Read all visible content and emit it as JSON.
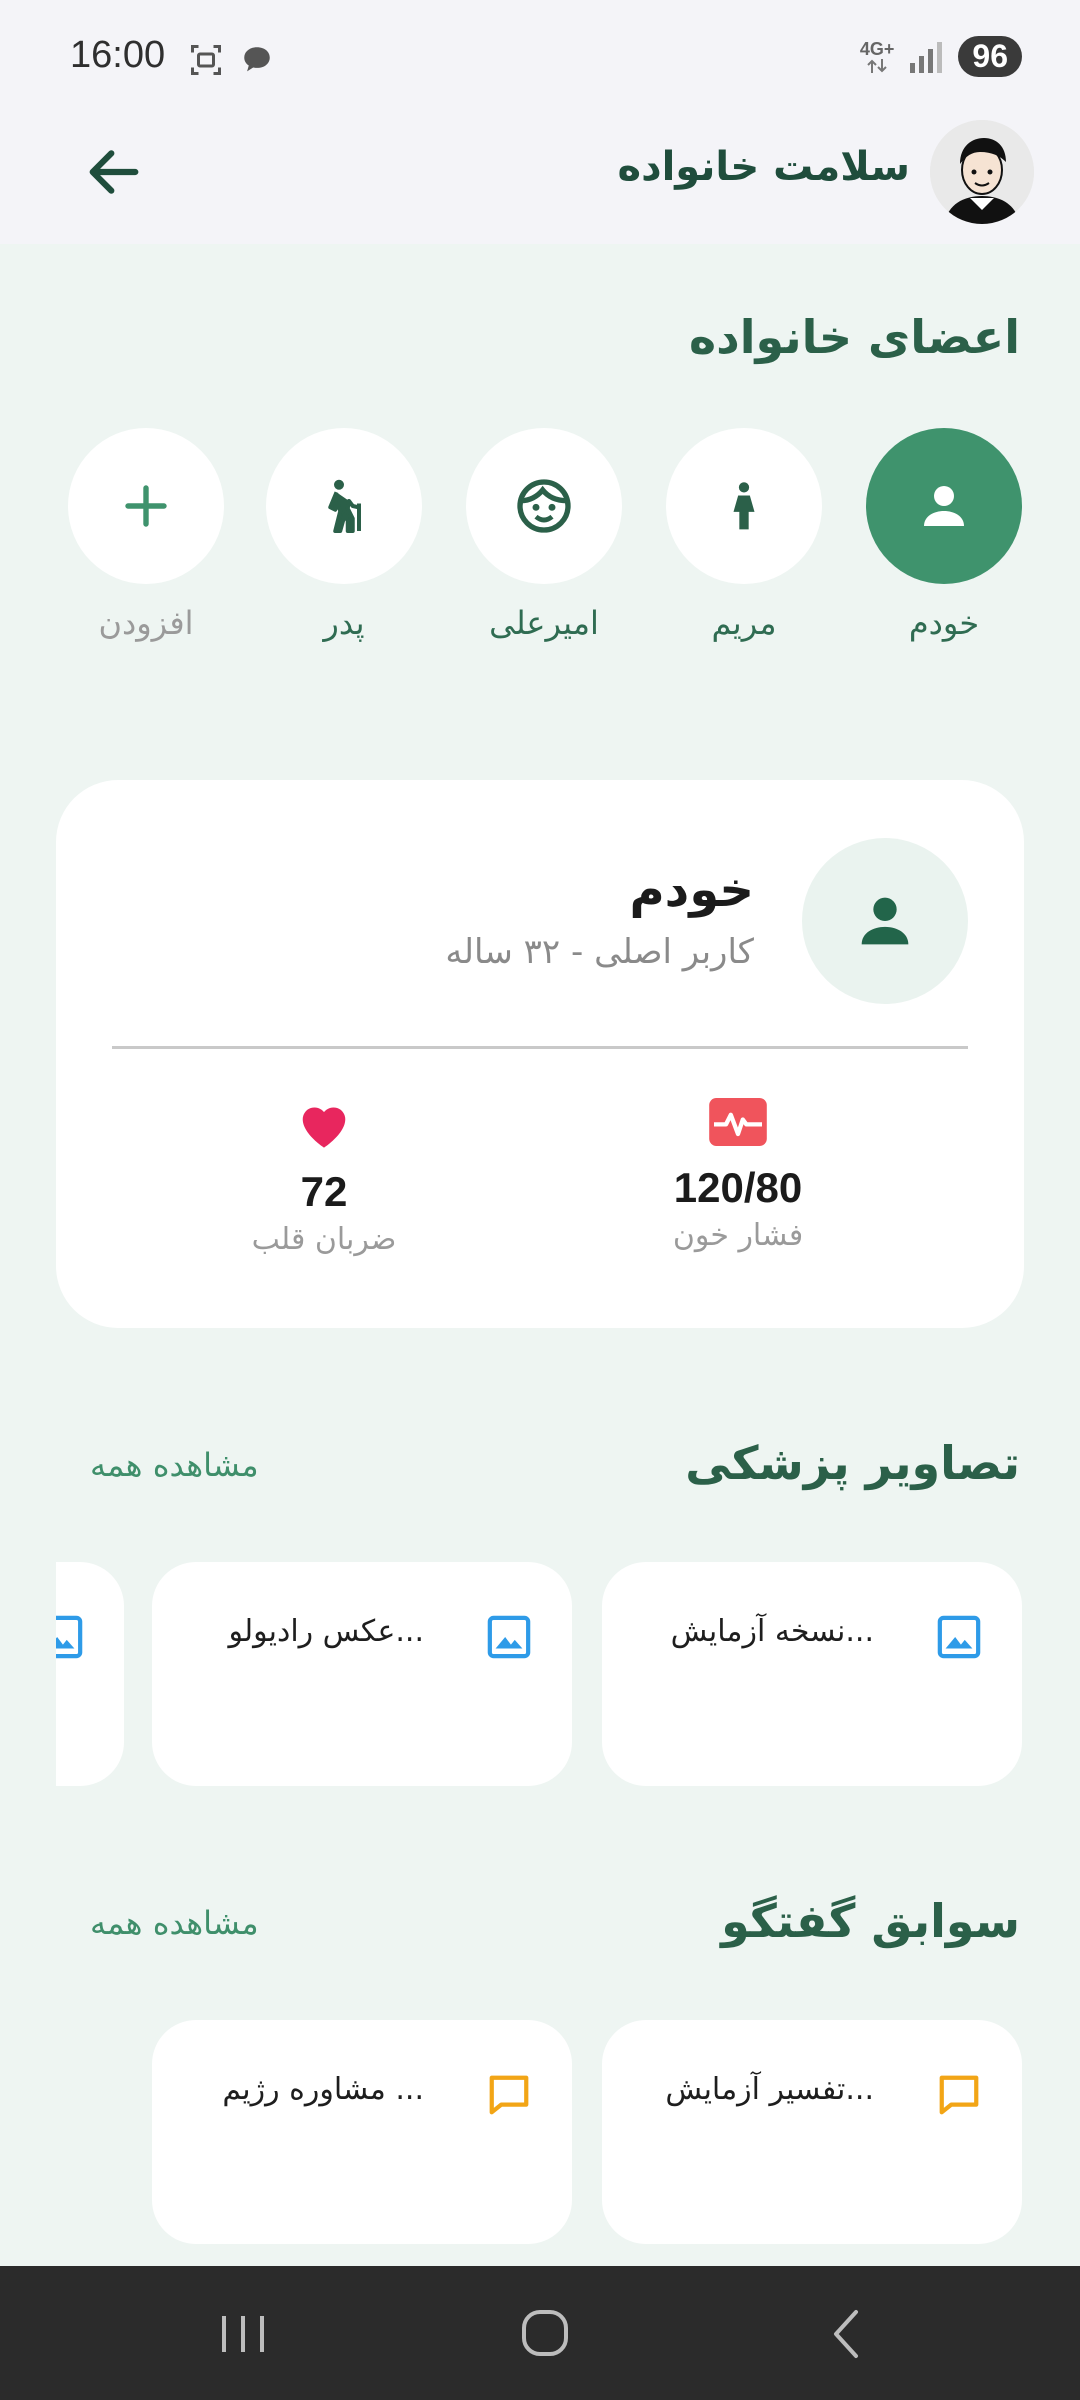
{
  "status": {
    "time": "16:00",
    "network": "4G+",
    "battery": "96"
  },
  "appbar": {
    "title": "سلامت خانواده"
  },
  "family": {
    "title": "اعضای خانواده",
    "members": [
      {
        "label": "خودم",
        "icon": "person-icon"
      },
      {
        "label": "مریم",
        "icon": "woman-icon"
      },
      {
        "label": "امیرعلی",
        "icon": "child-face-icon"
      },
      {
        "label": "پدر",
        "icon": "elderly-walk-icon"
      },
      {
        "label": "افزودن",
        "icon": "plus-icon"
      }
    ]
  },
  "profile": {
    "name": "خودم",
    "subtitle": "کاربر اصلی - ۳۲ ساله",
    "stats": [
      {
        "value": "120/80",
        "label": "فشار خون",
        "icon": "blood-pressure-icon",
        "color": "#f0545c"
      },
      {
        "value": "72",
        "label": "ضربان قلب",
        "icon": "heart-icon",
        "color": "#e8265e"
      }
    ]
  },
  "medical_images": {
    "title": "تصاویر پزشکی",
    "see_all": "مشاهده همه",
    "items": [
      {
        "label": "نسخه آزمایش...",
        "icon": "image-icon"
      },
      {
        "label": "عکس رادیولو...",
        "icon": "image-icon"
      }
    ]
  },
  "chats": {
    "title": "سوابق گفتگو",
    "see_all": "مشاهده همه",
    "items": [
      {
        "label": "تفسیر آزمایش...",
        "icon": "chat-icon"
      },
      {
        "label": "مشاوره رژیم ...",
        "icon": "chat-icon"
      }
    ]
  },
  "colors": {
    "primary": "#3f936d",
    "title": "#2b6049",
    "image_icon": "#2e9be8",
    "chat_icon": "#f2a516"
  }
}
